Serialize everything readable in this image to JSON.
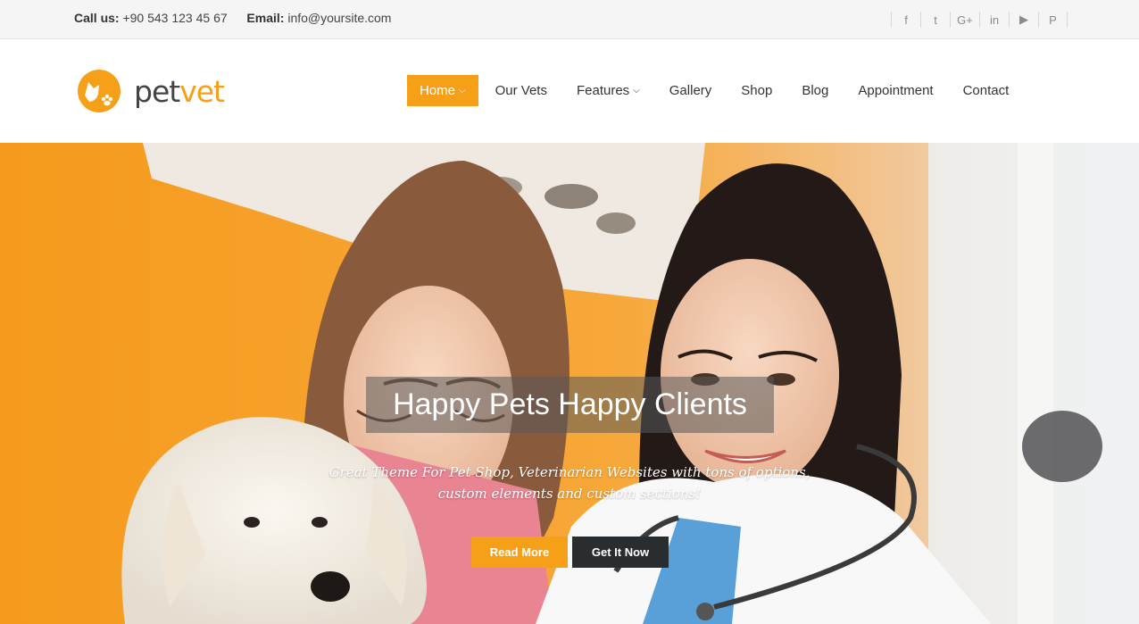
{
  "topbar": {
    "call_label": "Call us:",
    "phone": "+90 543 123 45 67",
    "email_label": "Email:",
    "email": "info@yoursite.com",
    "social": [
      {
        "icon": "facebook-icon",
        "glyph": "f"
      },
      {
        "icon": "twitter-icon",
        "glyph": "t"
      },
      {
        "icon": "google-plus-icon",
        "glyph": "G+"
      },
      {
        "icon": "linkedin-icon",
        "glyph": "in"
      },
      {
        "icon": "youtube-icon",
        "glyph": "▶"
      },
      {
        "icon": "pinterest-icon",
        "glyph": "P"
      }
    ]
  },
  "brand": {
    "name_part1": "pet",
    "name_part2": "vet",
    "accent_color": "#f5a018"
  },
  "nav": {
    "items": [
      {
        "label": "Home",
        "active": true,
        "has_dropdown": true
      },
      {
        "label": "Our Vets",
        "active": false,
        "has_dropdown": false
      },
      {
        "label": "Features",
        "active": false,
        "has_dropdown": true
      },
      {
        "label": "Gallery",
        "active": false,
        "has_dropdown": false
      },
      {
        "label": "Shop",
        "active": false,
        "has_dropdown": false
      },
      {
        "label": "Blog",
        "active": false,
        "has_dropdown": false
      },
      {
        "label": "Appointment",
        "active": false,
        "has_dropdown": false
      },
      {
        "label": "Contact",
        "active": false,
        "has_dropdown": false
      }
    ]
  },
  "hero": {
    "title": "Happy Pets Happy Clients",
    "subtitle_line1": "Great Theme For Pet Shop, Veterinarian Websites with tons of options,",
    "subtitle_line2": "custom elements and custom sections!",
    "button_primary": "Read More",
    "button_secondary": "Get It Now"
  }
}
